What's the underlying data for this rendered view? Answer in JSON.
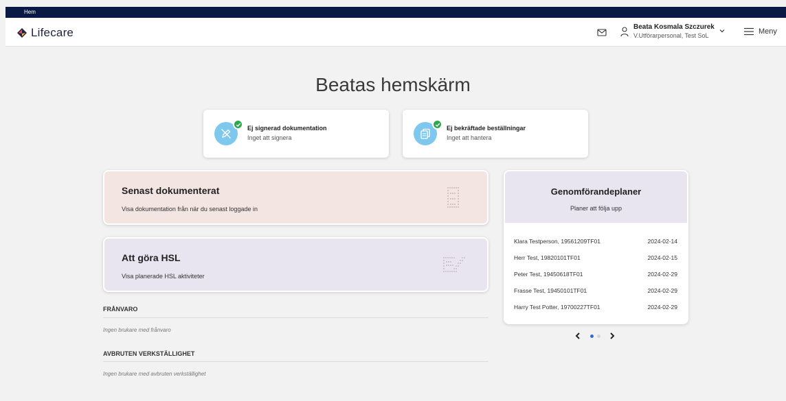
{
  "topbar": {
    "breadcrumb": "Hem"
  },
  "header": {
    "logo_text": "Lifecare",
    "user_name": "Beata Kosmala Szczurek",
    "user_role": "V.Utförarpersonal, Test SoL",
    "menu_label": "Meny"
  },
  "page_title": "Beatas hemskärm",
  "status_cards": [
    {
      "title": "Ej signerad dokumentation",
      "subtitle": "Inget att signera",
      "icon": "pen-off-icon"
    },
    {
      "title": "Ej bekräftade beställningar",
      "subtitle": "Inget att hantera",
      "icon": "clipboard-copy-icon"
    }
  ],
  "cards": [
    {
      "title": "Senast dokumenterat",
      "subtitle": "Visa dokumentation från när du senast loggade in",
      "icon": "document-list-icon",
      "bg": "#f3e5e1"
    },
    {
      "title": "Att göra HSL",
      "subtitle": "Visa planerade HSL aktiviteter",
      "icon": "edit-note-icon",
      "bg": "#e8e4f0"
    }
  ],
  "sections": [
    {
      "heading": "FRÅNVARO",
      "empty_text": "Ingen brukare med frånvaro"
    },
    {
      "heading": "AVBRUTEN VERKSTÄLLIGHET",
      "empty_text": "Ingen brukare med avbruten verkställighet"
    }
  ],
  "plans": {
    "title": "Genomförandeplaner",
    "subtitle": "Planer att följa upp",
    "rows": [
      {
        "name": "Klara Testperson, 19561209TF01",
        "date": "2024-02-14"
      },
      {
        "name": "Herr Test, 19820101TF01",
        "date": "2024-02-15"
      },
      {
        "name": "Peter Test, 19450618TF01",
        "date": "2024-02-29"
      },
      {
        "name": "Frasse Test, 19450101TF01",
        "date": "2024-02-29"
      },
      {
        "name": "Harry Test Potter, 19700227TF01",
        "date": "2024-02-29"
      }
    ],
    "pager": {
      "current_page": 1,
      "total_pages": 2
    }
  },
  "colors": {
    "topbar": "#0b1a45",
    "background": "#f2f2f2",
    "icon_circle": "#7ec8ee",
    "check_badge": "#2aa84a",
    "pager_active": "#2a6fd6"
  }
}
